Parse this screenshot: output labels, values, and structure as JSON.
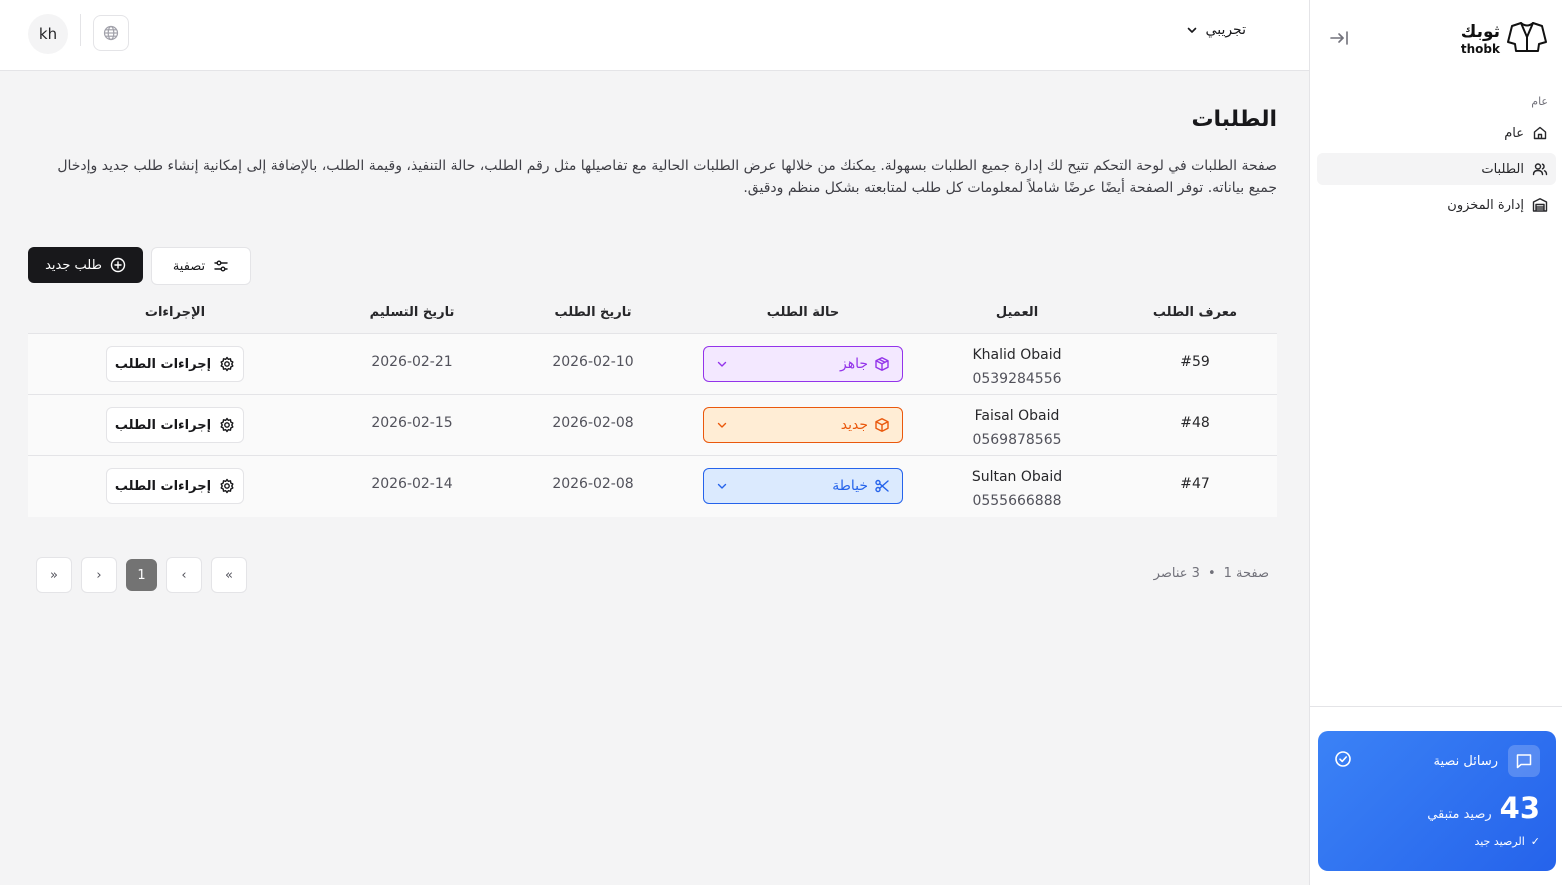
{
  "header": {
    "avatar_initials": "kh",
    "tenant_name": "تجريبي"
  },
  "sidebar": {
    "logo_ar": "ثوبك",
    "logo_en": "thobk",
    "section_label": "عام",
    "items": [
      {
        "label": "عام",
        "icon": "home-icon",
        "active": false
      },
      {
        "label": "الطلبات",
        "icon": "users-icon",
        "active": true
      },
      {
        "label": "إدارة المخزون",
        "icon": "inventory-icon",
        "active": false
      }
    ],
    "sms_card": {
      "title": "رسائل نصية",
      "balance": "43",
      "balance_label": "رصيد متبقي",
      "status": "الرصيد جيد",
      "status_mark": "✓",
      "accent": "#2563eb"
    }
  },
  "page": {
    "title": "الطلبات",
    "description": "صفحة الطلبات في لوحة التحكم تتيح لك إدارة جميع الطلبات بسهولة. يمكنك من خلالها عرض الطلبات الحالية مع تفاصيلها مثل رقم الطلب، حالة التنفيذ، وقيمة الطلب، بالإضافة إلى إمكانية إنشاء طلب جديد وإدخال جميع بياناته. توفر الصفحة أيضًا عرضًا شاملاً لمعلومات كل طلب لمتابعته بشكل منظم ودقيق.",
    "new_order_label": "طلب جديد",
    "filter_label": "تصفية"
  },
  "table": {
    "headers": {
      "order_id": "معرف الطلب",
      "customer": "العميل",
      "status": "حالة الطلب",
      "order_date": "تاريخ الطلب",
      "delivery_date": "تاريخ التسليم",
      "actions": "الإجراءات"
    },
    "rows": [
      {
        "id": "#59",
        "customer_name": "Khalid Obaid",
        "phone": "0539284556",
        "status": "جاهز",
        "status_color": "#9333ea",
        "order_date": "2026-02-10",
        "delivery_date": "2026-02-21",
        "action_label": "إجراءات الطلب"
      },
      {
        "id": "#48",
        "customer_name": "Faisal Obaid",
        "phone": "0569878565",
        "status": "جديد",
        "status_color": "#ea580c",
        "order_date": "2026-02-08",
        "delivery_date": "2026-02-15",
        "action_label": "إجراءات الطلب"
      },
      {
        "id": "#47",
        "customer_name": "Sultan Obaid",
        "phone": "0555666888",
        "status": "خياطة",
        "status_color": "#2563eb",
        "order_date": "2026-02-08",
        "delivery_date": "2026-02-14",
        "action_label": "إجراءات الطلب"
      }
    ]
  },
  "pagination": {
    "first": "«",
    "prev": "‹",
    "current": "1",
    "next": "›",
    "last": "»",
    "page_label": "صفحة 1",
    "separator": "•",
    "items_label": "3 عناصر"
  }
}
